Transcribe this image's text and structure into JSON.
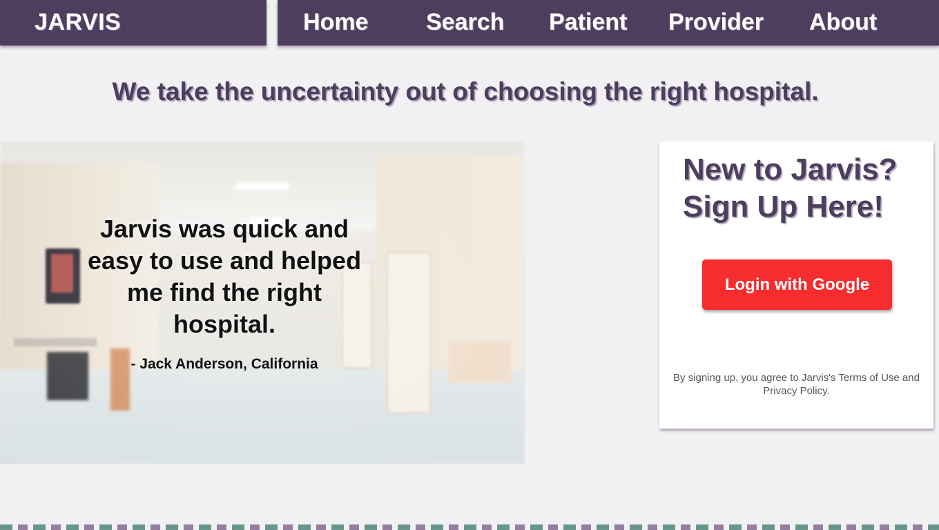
{
  "header": {
    "brand": "JARVIS",
    "nav": [
      {
        "label": "Home"
      },
      {
        "label": "Search"
      },
      {
        "label": "Patient"
      },
      {
        "label": "Provider"
      },
      {
        "label": "About"
      }
    ]
  },
  "main": {
    "headline": "We take the uncertainty out of choosing the right hospital.",
    "testimonial": {
      "quote": "Jarvis was quick and easy to use and helped me find the right hospital.",
      "attribution": "- Jack Anderson, California"
    },
    "signup": {
      "title": "New to Jarvis? Sign Up Here!",
      "button_label": "Login with Google",
      "terms": "By signing up, you agree to Jarvis's Terms of Use and Privacy Policy."
    }
  },
  "colors": {
    "header_bg": "#4d3e5e",
    "accent": "#4d3e5e",
    "google_button": "#f62c2f",
    "page_bg": "#f1f0f3"
  }
}
